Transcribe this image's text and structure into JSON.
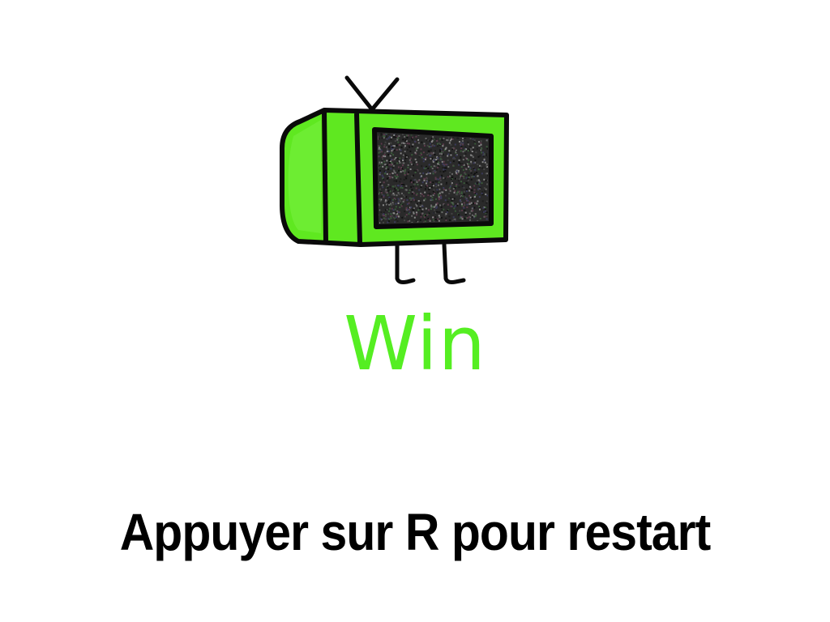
{
  "screen": {
    "title": "Win",
    "instruction": "Appuyer sur R pour restart"
  },
  "mascot": {
    "icon": "tv-mascot-icon"
  },
  "colors": {
    "background": "#ffffff",
    "title": "#55ee22",
    "tv_body": "#5fe820",
    "tv_outline": "#0a0a0a",
    "static_base": "#2a2a2a"
  }
}
